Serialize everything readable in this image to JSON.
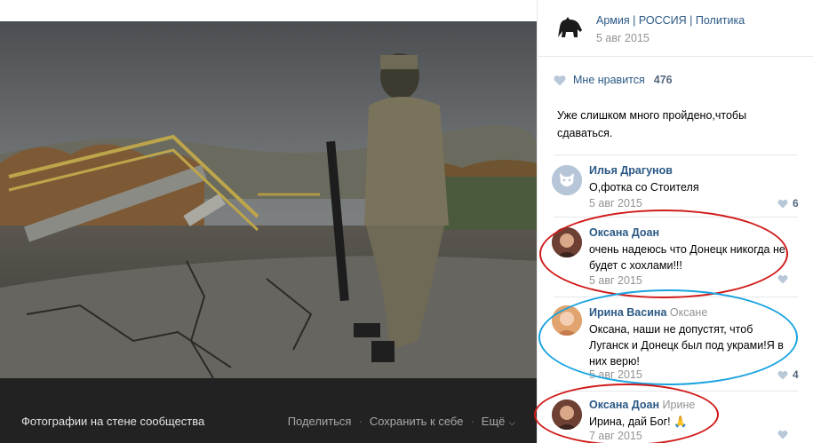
{
  "footer": {
    "title": "Фотографии на стене сообщества",
    "share": "Поделиться",
    "save": "Сохранить к себе",
    "more": "Ещё"
  },
  "post": {
    "group_name": "Армия | РОССИЯ | Политика",
    "date": "5 авг 2015",
    "likes_label": "Мне нравится",
    "likes_count": "476",
    "text": "Уже слишком много пройдено,чтобы сдаваться."
  },
  "comments": [
    {
      "author": "Илья Драгунов",
      "reply_to": "",
      "text": "О,фотка со Стоителя",
      "date": "5 авг 2015",
      "likes": "6"
    },
    {
      "author": "Оксана Доан",
      "reply_to": "",
      "text": "очень надеюсь что Донецк никогда не будет с хохлами!!!",
      "date": "5 авг 2015",
      "likes": ""
    },
    {
      "author": "Ирина Васина",
      "reply_to": "Оксане",
      "text": "Оксана, наши не допустят, чтоб Луганск и Донецк был под укрaми!Я в них верю!",
      "date": "5 авг 2015",
      "likes": "4"
    },
    {
      "author": "Оксана Доан",
      "reply_to": "Ирине",
      "text": "Ирина, дай Бог! 🙏",
      "date": "7 авг 2015",
      "likes": ""
    }
  ],
  "colors": {
    "link": "#2a5885",
    "muted": "#939393",
    "annotation_red": "#d11a1a",
    "annotation_blue": "#1aa3e0"
  }
}
